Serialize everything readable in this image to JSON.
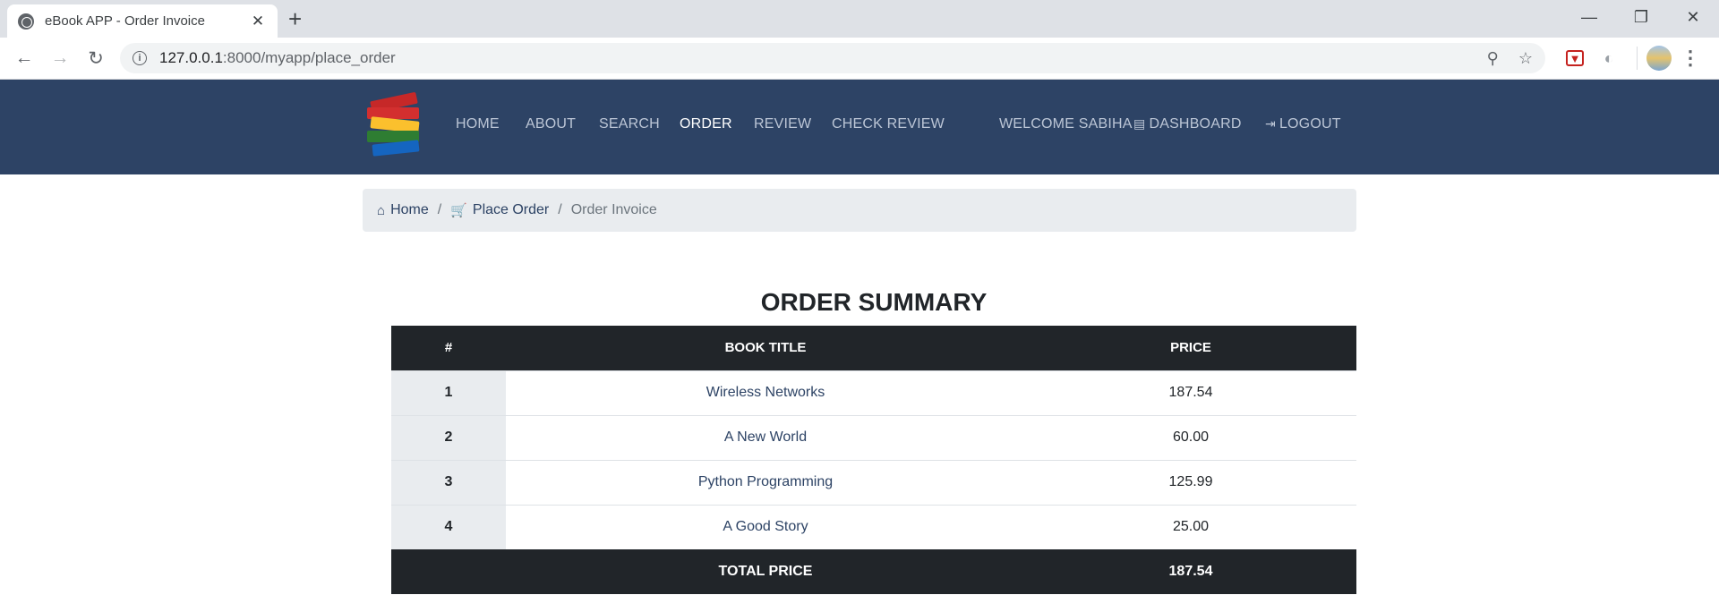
{
  "browser": {
    "tab_title": "eBook APP - Order Invoice",
    "tab_close": "✕",
    "new_tab": "+",
    "url_host": "127.0.0.1",
    "url_path": ":8000/myapp/place_order",
    "window_minimize": "—",
    "window_restore": "❐",
    "window_close": "✕"
  },
  "navbar": {
    "home": "HOME",
    "about": "ABOUT",
    "search": "SEARCH",
    "order": "ORDER",
    "review": "REVIEW",
    "check_review": "CHECK REVIEW",
    "welcome": "WELCOME SABIHA",
    "dashboard": "DASHBOARD",
    "logout": "LOGOUT"
  },
  "breadcrumb": {
    "home": "Home",
    "place_order": "Place Order",
    "current": "Order Invoice",
    "separator": "/"
  },
  "summary": {
    "title": "ORDER SUMMARY",
    "headers": {
      "num": "#",
      "book_title": "BOOK TITLE",
      "price": "PRICE"
    },
    "rows": [
      {
        "num": "1",
        "title": "Wireless Networks",
        "price": "187.54"
      },
      {
        "num": "2",
        "title": "A New World",
        "price": "60.00"
      },
      {
        "num": "3",
        "title": "Python Programming",
        "price": "125.99"
      },
      {
        "num": "4",
        "title": "A Good Story",
        "price": "25.00"
      }
    ],
    "total_label": "TOTAL PRICE",
    "total_value": "187.54"
  },
  "colors": {
    "navbar": "#2d4365",
    "table_dark": "#212529",
    "breadcrumb_bg": "#e9ecef"
  }
}
